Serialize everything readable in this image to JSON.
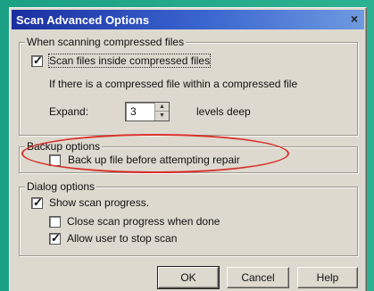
{
  "dialog": {
    "title": "Scan Advanced Options",
    "close_glyph": "×"
  },
  "compressed": {
    "legend": "When scanning compressed files",
    "scan_inside_label": "Scan files inside compressed files",
    "scan_inside_checked": true,
    "nested_text": "If there is a compressed file within a compressed file",
    "expand_label": "Expand:",
    "expand_value": "3",
    "levels_label": "levels deep"
  },
  "backup": {
    "legend": "Backup options",
    "backup_label": "Back up file before attempting repair",
    "backup_checked": false
  },
  "dialog_options": {
    "legend": "Dialog options",
    "show_progress_label": "Show scan progress.",
    "show_progress_checked": true,
    "close_progress_label": "Close scan progress when done",
    "close_progress_checked": false,
    "allow_stop_label": "Allow user to stop scan",
    "allow_stop_checked": true
  },
  "buttons": {
    "ok": "OK",
    "cancel": "Cancel",
    "help": "Help"
  },
  "colors": {
    "highlight_ellipse": "#d8302a",
    "titlebar_start": "#1a2fa0",
    "titlebar_end": "#6f9ae0"
  }
}
